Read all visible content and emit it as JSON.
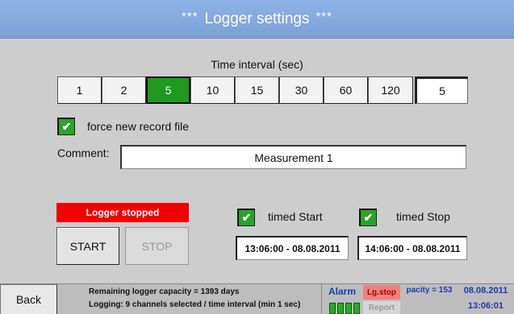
{
  "header": {
    "title": "Logger settings",
    "stars_left": "***",
    "stars_right": "***"
  },
  "interval": {
    "label": "Time interval (sec)",
    "options": [
      "1",
      "2",
      "5",
      "10",
      "15",
      "30",
      "60",
      "120"
    ],
    "selected": "5",
    "value": "5"
  },
  "force_new_record": {
    "label": "force new record file",
    "checked": true,
    "check_glyph": "✔"
  },
  "comment": {
    "label": "Comment:",
    "value": "Measurement 1"
  },
  "logger": {
    "status": "Logger stopped",
    "start_label": "START",
    "stop_label": "STOP",
    "timed_start": {
      "label": "timed Start",
      "checked": true,
      "value": "13:06:00 - 08.08.2011"
    },
    "timed_stop": {
      "label": "timed Stop",
      "checked": true,
      "value": "14:06:00 - 08.08.2011"
    }
  },
  "footer": {
    "back_label": "Back",
    "capacity_text": "Remaining logger capacity = 1393 days",
    "logging_text": "Logging:  9 channels selected / time interval (min 1 sec)",
    "alarm_label": "Alarm",
    "lgstop_label": "Lg.stop",
    "report_label": "Report",
    "capacity_short": "pacity = 153",
    "date": "08.08.2011",
    "time": "13:06:01"
  },
  "colors": {
    "title_bar": "#7fa6dc",
    "selected_green": "#1e9a1e",
    "stopped_red": "#f20000",
    "footer_blue_text": "#1a3db0"
  }
}
